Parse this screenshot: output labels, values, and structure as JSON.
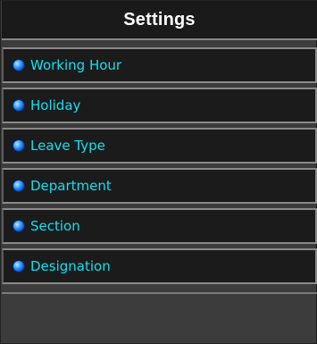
{
  "header": {
    "title": "Settings"
  },
  "menu": {
    "items": [
      {
        "label": "Working Hour",
        "icon": "blue-bullet-icon"
      },
      {
        "label": "Holiday",
        "icon": "blue-bullet-icon"
      },
      {
        "label": "Leave Type",
        "icon": "blue-bullet-icon"
      },
      {
        "label": "Department",
        "icon": "blue-bullet-icon"
      },
      {
        "label": "Section",
        "icon": "blue-bullet-icon"
      },
      {
        "label": "Designation",
        "icon": "blue-bullet-icon"
      }
    ]
  },
  "colors": {
    "panel_bg": "#3c3c3c",
    "header_bg": "#1a1a1a",
    "item_bg": "#1b1b1b",
    "label_text": "#10e0f0",
    "bullet": "#1a73ff"
  }
}
